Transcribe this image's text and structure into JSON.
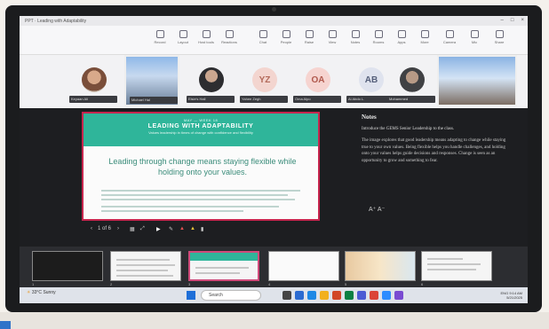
{
  "window": {
    "title": "PPT · Leading with Adaptability"
  },
  "ribbon": {
    "tools": [
      {
        "label": "Record",
        "icon": "record-icon"
      },
      {
        "label": "Layout",
        "icon": "layout-icon"
      },
      {
        "label": "Host tools",
        "icon": "shield-icon"
      },
      {
        "label": "Reactions",
        "icon": "reactions-icon"
      },
      {
        "label": "Chat",
        "icon": "chat-icon"
      },
      {
        "label": "People",
        "icon": "people-icon"
      },
      {
        "label": "Raise",
        "icon": "hand-icon"
      },
      {
        "label": "View",
        "icon": "view-icon"
      },
      {
        "label": "Notes",
        "icon": "notes-icon"
      },
      {
        "label": "Rooms",
        "icon": "rooms-icon"
      },
      {
        "label": "Apps",
        "icon": "apps-icon"
      },
      {
        "label": "More",
        "icon": "more-icon"
      },
      {
        "label": "Camera",
        "icon": "camera-icon"
      },
      {
        "label": "Mic",
        "icon": "mic-icon"
      },
      {
        "label": "Share",
        "icon": "share-icon"
      }
    ]
  },
  "participants": [
    {
      "initials": "",
      "name": "Keyaan Ali",
      "kind": "photo-avatar"
    },
    {
      "initials": "",
      "name": "Michael Hal",
      "kind": "video"
    },
    {
      "initials": "",
      "name": "Elsie's Hall",
      "kind": "photo-avatar"
    },
    {
      "initials": "YZ",
      "name": "Yahee Zegh",
      "kind": "initials"
    },
    {
      "initials": "OA",
      "name": "Oma Alpo",
      "kind": "initials"
    },
    {
      "initials": "AB",
      "name": "Al Abdo L.",
      "kind": "initials"
    },
    {
      "initials": "",
      "name": "Mohammed",
      "kind": "photo-avatar"
    },
    {
      "initials": "",
      "name": "",
      "kind": "video-self"
    }
  ],
  "slide": {
    "kicker": "MAY — WEEK 18",
    "title": "LEADING WITH ADAPTABILITY",
    "subtitle": "Values leadership in times of change with confidence and flexibility",
    "headline": "Leading through change means staying flexible while holding onto your values."
  },
  "controls": {
    "counter": "1 of 6"
  },
  "notes": {
    "heading": "Notes",
    "line1": "Introduce the GEMS Senior Leadership to the class.",
    "line2": "The image explores that good leadership means adapting to change while staying true to your own values. Being flexible helps you handle challenges, and holding onto your values helps guide decisions and responses. Change is seen as an opportunity to grow and something to fear."
  },
  "thumbnails": [
    {
      "num": "1",
      "kind": "dark"
    },
    {
      "num": "2",
      "kind": "table"
    },
    {
      "num": "3",
      "kind": "selected"
    },
    {
      "num": "4",
      "kind": "blank"
    },
    {
      "num": "5",
      "kind": "collage"
    },
    {
      "num": "6",
      "kind": "text"
    }
  ],
  "taskbar": {
    "weather_temp": "33°C",
    "weather_desc": "Sunny",
    "search": "Search",
    "time": "9:14 AM",
    "date": "5/21/2025",
    "lang": "ENG"
  },
  "colors": {
    "accent": "#2fb59a",
    "slide_border": "#c7254e",
    "start": "#1f6fd8"
  }
}
